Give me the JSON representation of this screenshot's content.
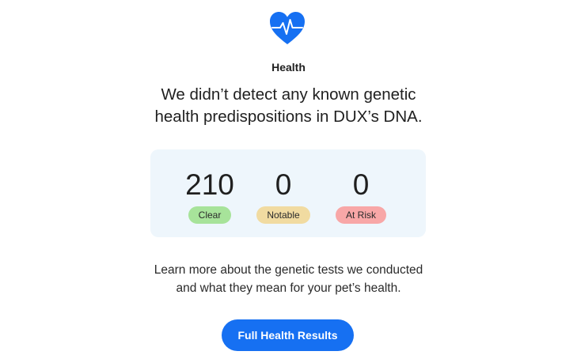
{
  "header": {
    "icon": "heart-pulse-icon",
    "section_label": "Health"
  },
  "headline": {
    "line1": "We didn’t detect any known genetic",
    "line2": "health predispositions in DUX’s DNA."
  },
  "summary": {
    "clear": {
      "count": "210",
      "label": "Clear",
      "color": "#a7e39a"
    },
    "notable": {
      "count": "0",
      "label": "Notable",
      "color": "#f1dba1"
    },
    "at_risk": {
      "count": "0",
      "label": "At Risk",
      "color": "#f8a7a7"
    }
  },
  "info": {
    "line1": "Learn more about the genetic tests we conducted",
    "line2": "and what they mean for your pet’s health."
  },
  "cta": {
    "label": "Full Health Results",
    "color": "#1670f2"
  }
}
